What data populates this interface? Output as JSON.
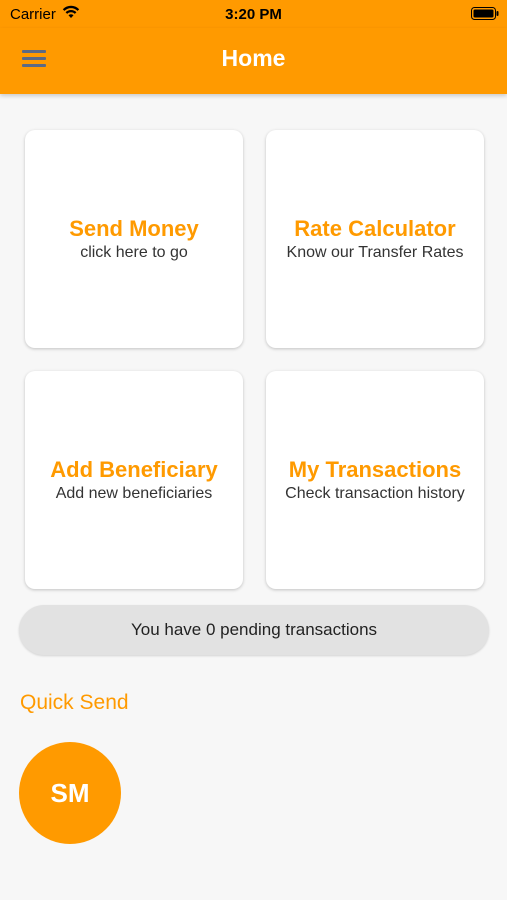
{
  "status_bar": {
    "carrier": "Carrier",
    "time": "3:20 PM"
  },
  "app_bar": {
    "title": "Home",
    "menu_icon": "hamburger-menu-icon"
  },
  "cards": [
    {
      "title": "Send Money",
      "subtitle": "click here to go"
    },
    {
      "title": "Rate Calculator",
      "subtitle": "Know our Transfer Rates"
    },
    {
      "title": "Add Beneficiary",
      "subtitle": "Add new beneficiaries"
    },
    {
      "title": "My Transactions",
      "subtitle": "Check transaction history"
    }
  ],
  "pending": {
    "text": "You have 0 pending transactions"
  },
  "quick_send": {
    "label": "Quick Send",
    "contacts": [
      {
        "initials": "SM"
      }
    ]
  },
  "colors": {
    "accent": "#ff9a00",
    "background": "#f7f7f7",
    "pending_bg": "#e2e2e2"
  }
}
